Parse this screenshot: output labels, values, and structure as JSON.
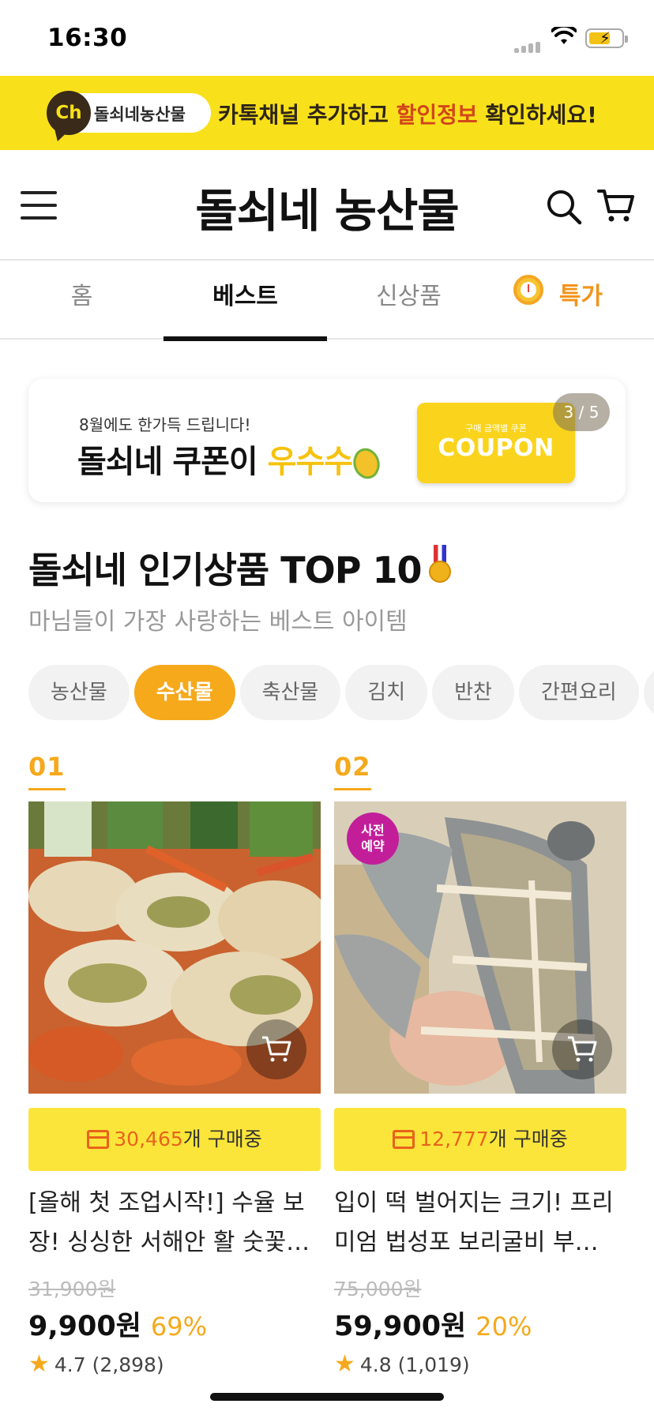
{
  "status": {
    "time": "16:30"
  },
  "kakao_banner": {
    "ch_badge": "Ch",
    "channel_name": "돌쇠네농산물",
    "text_before": "카톡채널 추가하고 ",
    "text_highlight": "할인정보",
    "text_after": " 확인하세요!"
  },
  "header": {
    "logo": "돌쇠네 농산물"
  },
  "tabs": [
    {
      "label": "홈"
    },
    {
      "label": "베스트"
    },
    {
      "label": "신상품"
    },
    {
      "label": "특가"
    }
  ],
  "coupon_banner": {
    "line1": "8월에도 한가득 드립니다!",
    "line2_main": "돌쇠네 쿠폰이 ",
    "line2_highlight": "우수수",
    "ticket_small": "구매 금액별 쿠폰",
    "ticket_big": "COUPON",
    "pager": "3 / 5"
  },
  "section": {
    "title": "돌쇠네 인기상품 TOP 10",
    "subtitle": "마님들이 가장 사랑하는 베스트 아이템"
  },
  "chips": [
    {
      "label": "농산물"
    },
    {
      "label": "수산물"
    },
    {
      "label": "축산물"
    },
    {
      "label": "김치"
    },
    {
      "label": "반찬"
    },
    {
      "label": "간편요리"
    }
  ],
  "products": [
    {
      "rank": "01",
      "buy_count": "30,465",
      "buy_suffix": "개 구매중",
      "name": "[올해 첫 조업시작!] 수율 보장! 싱싱한 서해안 활 숫꽃…",
      "orig_price": "31,900원",
      "price": "9,900원",
      "discount": "69%",
      "rating": "4.7 (2,898)"
    },
    {
      "rank": "02",
      "badge": "사전예약",
      "buy_count": "12,777",
      "buy_suffix": "개 구매중",
      "name": "입이 떡 벌어지는 크기! 프리미엄 법성포 보리굴비 부…",
      "orig_price": "75,000원",
      "price": "59,900원",
      "discount": "20%",
      "rating": "4.8 (1,019)"
    }
  ],
  "colors": {
    "kakao_yellow": "#f8e11a",
    "accent_orange": "#f5a91c",
    "active_chip": "#f6a91a",
    "buy_bar": "#fbe53a"
  }
}
